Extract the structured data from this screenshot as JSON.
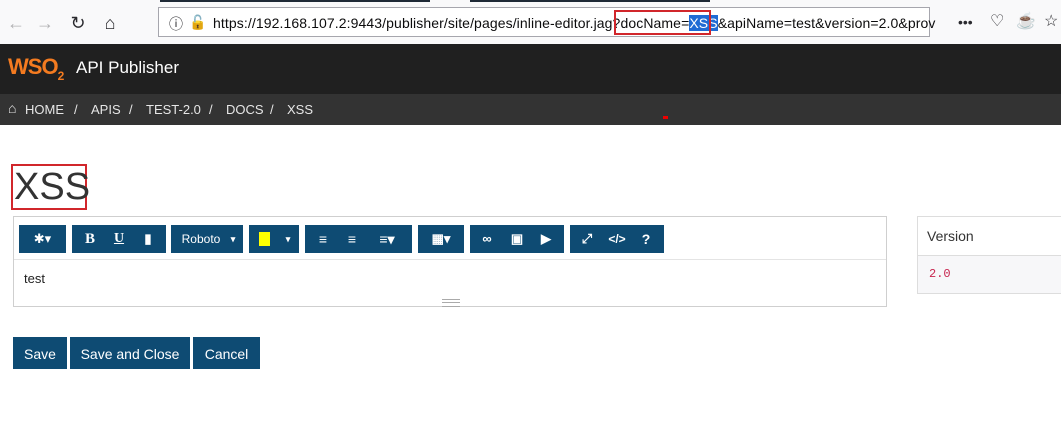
{
  "browser": {
    "url": "https://192.168.107.2:9443/publisher/site/pages/inline-editor.jag?",
    "url_param_key": "docName=",
    "url_param_value": "XSS",
    "url_rest": "&apiName=test&version=2.0&prov",
    "menu_dots": "•••"
  },
  "app": {
    "logo_text": "WSO",
    "logo_sub": "2",
    "title": "API Publisher"
  },
  "breadcrumb": {
    "home": "HOME",
    "sep": "/",
    "items": [
      "APIS",
      "TEST-2.0",
      "DOCS",
      "XSS"
    ]
  },
  "doc": {
    "title": "XSS",
    "content": "test"
  },
  "toolbar": {
    "bold": "B",
    "underline": "U",
    "font": "Roboto",
    "help": "?"
  },
  "side": {
    "version_label": "Version",
    "version_value": "2.0"
  },
  "actions": {
    "save": "Save",
    "save_close": "Save and Close",
    "cancel": "Cancel"
  },
  "colors": {
    "primary": "#0e4b73",
    "header": "#202020",
    "breadcrumb": "#333333",
    "highlight": "#d1262b"
  }
}
